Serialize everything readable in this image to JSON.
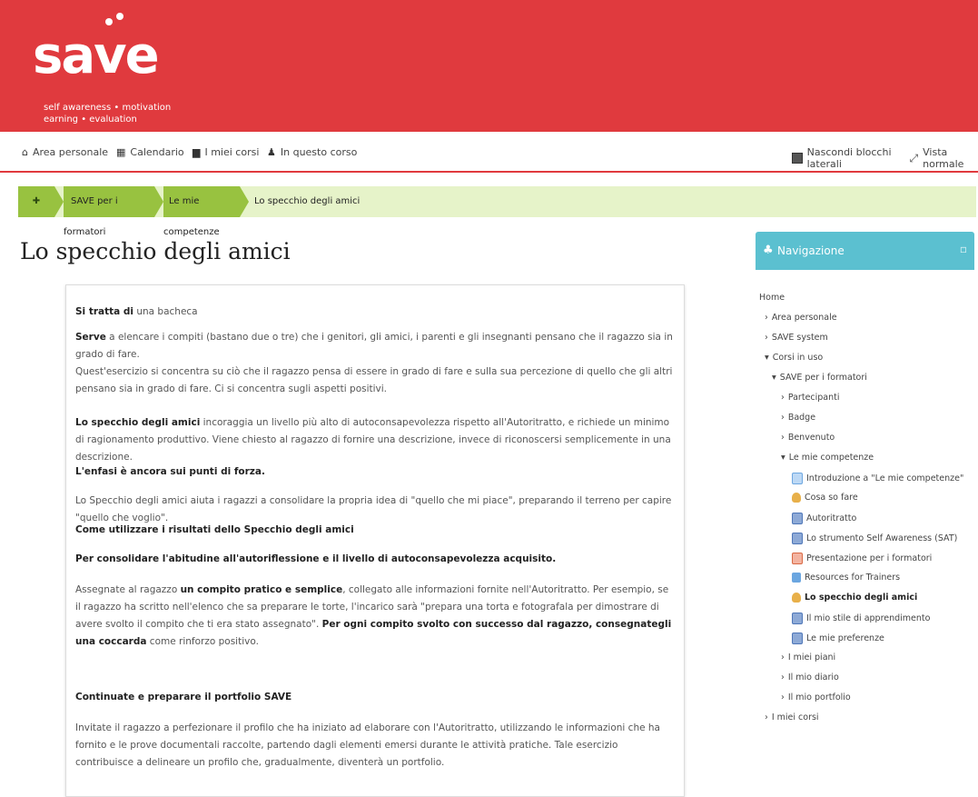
{
  "logo": {
    "word": "save",
    "tagline": "self awareness • motivation earning • evaluation"
  },
  "navbar": {
    "items": [
      {
        "icon": "home-icon",
        "glyph": "⌂",
        "label": "Area personale"
      },
      {
        "icon": "calendar-icon",
        "glyph": "▦",
        "label": "Calendario"
      },
      {
        "icon": "courses-icon",
        "glyph": "▆",
        "label": "I miei corsi"
      },
      {
        "icon": "course-icon",
        "glyph": "♟",
        "label": "In questo corso"
      }
    ],
    "hide_blocks": "Nascondi blocchi laterali",
    "normal_view": "Vista normale"
  },
  "breadcrumb": {
    "home_glyph": "✚",
    "items": [
      "SAVE per i formatori",
      "Le mie competenze",
      "Lo specchio degli amici"
    ]
  },
  "page_title": "Lo specchio degli amici",
  "content": {
    "p1": {
      "b": "Si tratta di",
      "t": " una bacheca"
    },
    "p2": {
      "b": "Serve",
      "t": " a elencare i compiti (bastano due o tre) che i genitori, gli amici, i parenti e gli insegnanti pensano che il ragazzo sia in grado di fare."
    },
    "p3": "Quest'esercizio si concentra su ciò che il ragazzo pensa di essere in grado di fare e sulla sua percezione di quello che gli altri pensano sia in grado di fare. Ci si concentra sugli aspetti positivi.",
    "p4": {
      "b": "Lo specchio degli amici",
      "t": " incoraggia un livello più alto di autoconsapevolezza rispetto all'Autoritratto, e richiede un minimo di ragionamento produttivo. Viene chiesto al ragazzo di fornire una descrizione, invece di riconoscersi semplicemente in una descrizione."
    },
    "p5": "L'enfasi è ancora sui punti di forza.",
    "p6": "Lo Specchio degli amici aiuta i ragazzi a consolidare la propria idea di \"quello che mi piace\", preparando il terreno per capire \"quello che voglio\".",
    "p7": "Come utilizzare i risultati dello Specchio degli amici",
    "p8": "Per consolidare l'abitudine all'autoriflessione e il livello di autoconsapevolezza acquisito.",
    "p9": {
      "t1": "Assegnate al ragazzo ",
      "b1": "un compito pratico e semplice",
      "t2": ", collegato alle informazioni fornite nell'Autoritratto. Per esempio, se il ragazzo ha scritto nell'elenco che sa preparare le torte, l'incarico sarà \"prepara una torta e fotografala per dimostrare di avere svolto il compito che ti era stato assegnato\". ",
      "b2": "Per ogni compito svolto con successo dal ragazzo, consegnategli una coccarda",
      "t3": " come rinforzo positivo."
    },
    "p10": "Continuate e preparare il portfolio SAVE",
    "p11": "Invitate il ragazzo a perfezionare il profilo che ha iniziato ad elaborare con l'Autoritratto, utilizzando le informazioni che ha fornito e le prove documentali raccolte, partendo dagli elementi emersi durante le attività pratiche. Tale esercizio contribuisce a delineare un profilo che, gradualmente, diventerà un portfolio."
  },
  "nav_block": {
    "title": "Navigazione",
    "home": "Home",
    "items": {
      "area": "Area personale",
      "save_system": "SAVE system",
      "corsi_in_uso": "Corsi in uso",
      "save_formatori": "SAVE per i formatori",
      "partecipanti": "Partecipanti",
      "badge": "Badge",
      "benvenuto": "Benvenuto",
      "competenze": "Le mie competenze",
      "introduzione": "Introduzione a \"Le mie competenze\"",
      "cosa_so_fare": "Cosa so fare",
      "autoritratto": "Autoritratto",
      "sat": "Lo strumento Self Awareness (SAT)",
      "presentazione": "Presentazione per i formatori",
      "resources": "Resources for Trainers",
      "specchio": "Lo specchio degli amici",
      "stile": "Il mio stile di apprendimento",
      "preferenze": "Le mie preferenze",
      "piani": "I miei piani",
      "diario": "Il mio diario",
      "portfolio": "Il mio portfolio",
      "miei_corsi": "I miei corsi"
    }
  }
}
